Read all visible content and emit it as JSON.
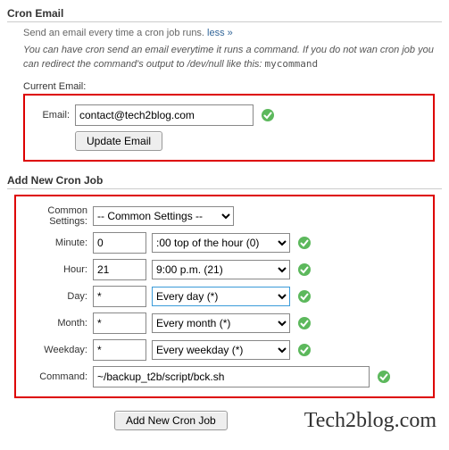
{
  "section1": {
    "title": "Cron Email",
    "intro_text": "Send an email every time a cron job runs. ",
    "less_link": "less »",
    "desc_prefix": "You can have cron send an email everytime it runs a command. If you do not wan cron job you can redirect the command's output to /dev/null like this: ",
    "desc_code": "mycommand",
    "current_label": "Current Email:",
    "email_label": "Email:",
    "email_value": "contact@tech2blog.com",
    "update_btn": "Update Email"
  },
  "section2": {
    "title": "Add New Cron Job",
    "common_label": "Common Settings:",
    "common_value": "-- Common Settings --",
    "rows": [
      {
        "label": "Minute:",
        "short": "0",
        "select": ":00 top of the hour (0)"
      },
      {
        "label": "Hour:",
        "short": "21",
        "select": "9:00 p.m. (21)"
      },
      {
        "label": "Day:",
        "short": "*",
        "select": "Every day (*)"
      },
      {
        "label": "Month:",
        "short": "*",
        "select": "Every month (*)"
      },
      {
        "label": "Weekday:",
        "short": "*",
        "select": "Every weekday (*)"
      }
    ],
    "command_label": "Command:",
    "command_value": "~/backup_t2b/script/bck.sh",
    "add_btn": "Add New Cron Job"
  },
  "watermark": "Tech2blog.com"
}
